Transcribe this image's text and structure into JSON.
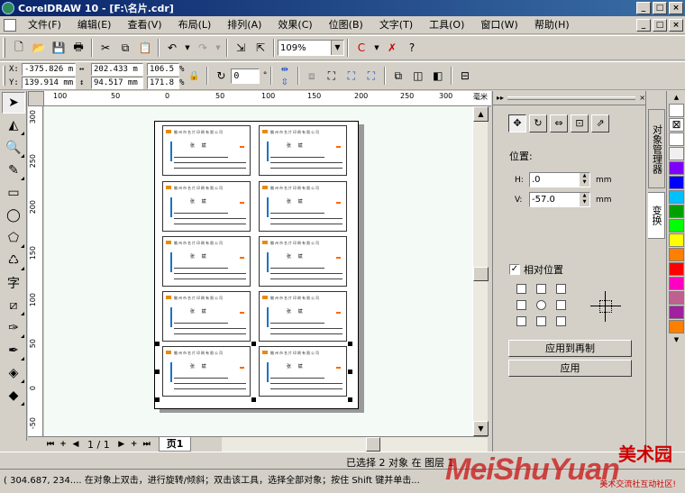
{
  "window": {
    "title": "CorelDRAW 10 - [F:\\名片.cdr]"
  },
  "menu": [
    "文件(F)",
    "编辑(E)",
    "查看(V)",
    "布局(L)",
    "排列(A)",
    "效果(C)",
    "位图(B)",
    "文字(T)",
    "工具(O)",
    "窗口(W)",
    "帮助(H)"
  ],
  "toolbar": {
    "zoom_value": "109%"
  },
  "propbar": {
    "x_label": "X:",
    "x_value": "-375.826 m",
    "y_label": "Y:",
    "y_value": "139.914 mm",
    "w_value": "202.433 m",
    "h_value": "94.517 mm",
    "sx_value": "106.5",
    "sy_value": "171.8",
    "pct": "%",
    "angle_value": "0",
    "deg": "°"
  },
  "ruler": {
    "unit": "毫米",
    "h_labels": [
      "100",
      "50",
      "0",
      "50",
      "100",
      "150",
      "200",
      "250",
      "300"
    ],
    "v_labels": [
      "300",
      "250",
      "200",
      "150",
      "100",
      "50",
      "0",
      "-50"
    ]
  },
  "card": {
    "header": "徽州市名片印刷有限公司",
    "name": "张  斌"
  },
  "page_nav": {
    "count": "1 / 1",
    "tab": "页1"
  },
  "docker": {
    "section": "位置:",
    "h_label": "H:",
    "h_value": ".0",
    "v_label": "V:",
    "v_value": "-57.0",
    "unit": "mm",
    "relative_label": "相对位置",
    "relative_checked": true,
    "apply_dup_label": "应用到再制",
    "apply_label": "应用"
  },
  "vtabs": [
    "对象管理器",
    "变换"
  ],
  "palette": [
    "#ffffff",
    "#000000",
    "#ffffff",
    "#f0f0f0",
    "#8000ff",
    "#0000ff",
    "#00c0ff",
    "#00a000",
    "#00ff00",
    "#ffff00",
    "#ff8000",
    "#ff0000",
    "#ff00c0",
    "#c06090",
    "#a020a0",
    "#ff8000"
  ],
  "status": {
    "selection": "已选择 2 对象 在 图层 1",
    "hint": "( 304.687, 234....  在对象上双击，进行旋转/倾斜；双击该工具，选择全部对象；按住 Shift 键并单击..."
  },
  "watermark": {
    "brand": "MeiShuYuan",
    "site": "美术园",
    "sub": "美术交流社互动社区!"
  }
}
